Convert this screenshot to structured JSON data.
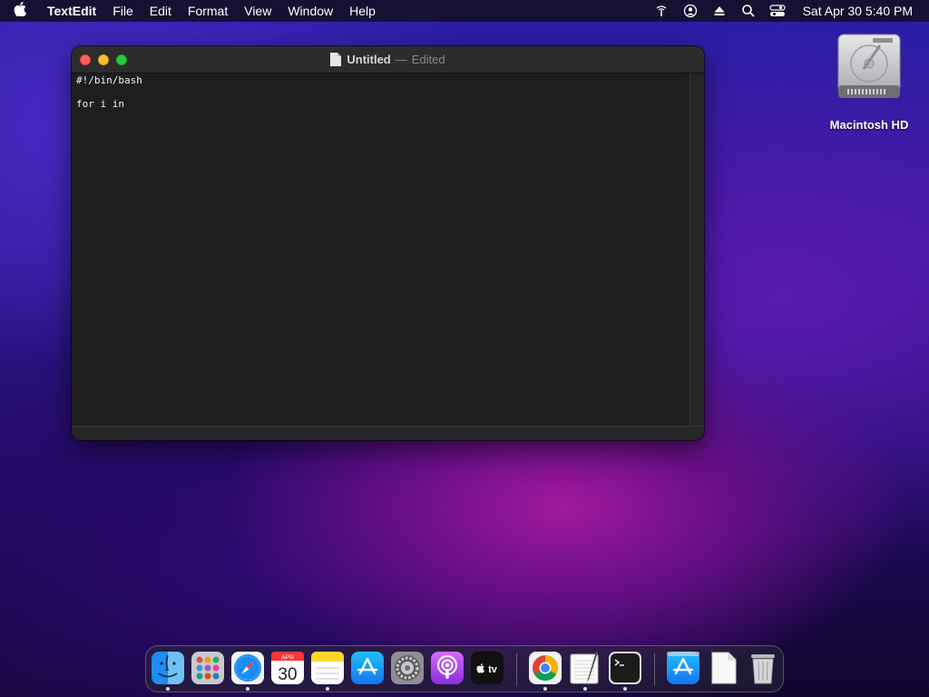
{
  "menubar": {
    "app_name": "TextEdit",
    "menus": [
      "File",
      "Edit",
      "Format",
      "View",
      "Window",
      "Help"
    ],
    "clock": "Sat Apr 30  5:40 PM"
  },
  "window": {
    "title": "Untitled",
    "separator": "—",
    "status": "Edited",
    "lines": [
      "#!/bin/bash",
      "",
      "for i in"
    ]
  },
  "desktop": {
    "disk_label": "Macintosh HD"
  },
  "dock": {
    "items": [
      "finder",
      "launchpad",
      "safari",
      "calendar",
      "notes",
      "app-store",
      "system-preferences",
      "podcasts",
      "apple-tv",
      "chrome",
      "textedit",
      "terminal",
      "app-store-download",
      "document",
      "trash"
    ],
    "calendar_month": "APR",
    "calendar_day": "30",
    "tv_label": "tv"
  },
  "colors": {
    "close": "#fe5f57",
    "minimize": "#febc2e",
    "maximize": "#28c840"
  }
}
